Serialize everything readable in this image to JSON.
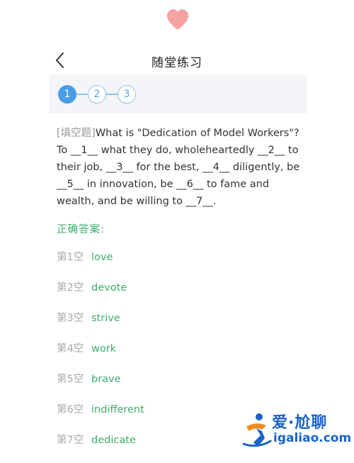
{
  "header": {
    "title": "随堂练习"
  },
  "steps": [
    "1",
    "2",
    "3"
  ],
  "question": {
    "tag": "[填空题]",
    "text": "What is \"Dedication of Model Workers\"? To __1__ what they do, wholeheartedly __2__ to their job, __3__ for the best, __4__ diligently, be __5__ in innovation, be __6__ to fame and wealth, and be willing to __7__."
  },
  "answers": {
    "title": "正确答案:",
    "items": [
      {
        "label": "第1空",
        "value": "love"
      },
      {
        "label": "第2空",
        "value": "devote"
      },
      {
        "label": "第3空",
        "value": "strive"
      },
      {
        "label": "第4空",
        "value": "work"
      },
      {
        "label": "第5空",
        "value": "brave"
      },
      {
        "label": "第6空",
        "value": "indifferent"
      },
      {
        "label": "第7空",
        "value": "dedicate"
      }
    ]
  },
  "watermark": {
    "name": "爱·尬聊",
    "url": "igaliao.com"
  },
  "colors": {
    "accent": "#4a9ee8",
    "answer": "#3fae6e",
    "heart": "#f6a3a3",
    "watermark": "#1a63c7"
  }
}
